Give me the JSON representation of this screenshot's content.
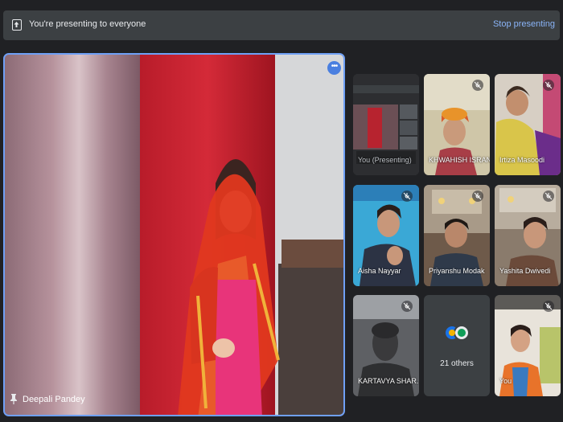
{
  "banner": {
    "text": "You're presenting to everyone",
    "stop_label": "Stop presenting"
  },
  "main_speaker": {
    "name": "Deepali Pandey"
  },
  "tiles": [
    {
      "name": "You (Presenting)",
      "muted": false
    },
    {
      "name": "KHWAHISH ISRANI",
      "muted": true
    },
    {
      "name": "Irtiza Masoodi",
      "muted": true
    },
    {
      "name": "Aisha Nayyar",
      "muted": true
    },
    {
      "name": "Priyanshu Modak",
      "muted": true
    },
    {
      "name": "Yashita Dwivedi",
      "muted": true
    },
    {
      "name": "KARTAVYA SHAR...",
      "muted": true
    },
    {
      "name": "You",
      "muted": true
    }
  ],
  "others": {
    "label": "21 others"
  },
  "colors": {
    "background": "#202124",
    "banner": "#3c4043",
    "accent_blue": "#8ab4f8",
    "active_border": "#6fa0f6"
  }
}
